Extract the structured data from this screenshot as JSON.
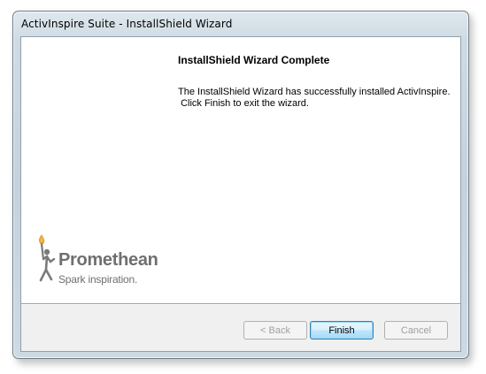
{
  "window": {
    "title": "ActivInspire Suite - InstallShield Wizard"
  },
  "main": {
    "heading": "InstallShield Wizard Complete",
    "message": "The InstallShield Wizard has successfully installed ActivInspire.\n Click Finish to exit the wizard."
  },
  "logo": {
    "name": "Promethean",
    "tagline": "Spark inspiration."
  },
  "buttons": {
    "back": "< Back",
    "finish": "Finish",
    "cancel": "Cancel"
  },
  "colors": {
    "flame": "#e8a33a",
    "logo_gray": "#6f6f6f"
  }
}
